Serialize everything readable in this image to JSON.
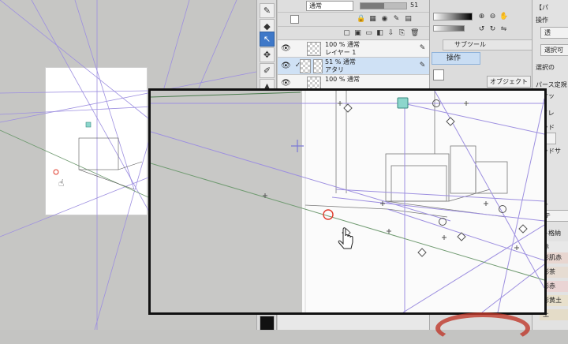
{
  "layer_panel": {
    "blend_mode": "通常",
    "opacity_value": "51",
    "layers": [
      {
        "opacity_line": "100 % 通常",
        "name": "レイヤー 1"
      },
      {
        "opacity_line": "51 % 通常",
        "name": "アタリ"
      },
      {
        "opacity_line": "100 % 通常",
        "name": ""
      }
    ]
  },
  "subtool_panel": {
    "tab_label": "サブツール",
    "operation_label": "操作",
    "object_label": "オブジェクト"
  },
  "property_panel": {
    "header_label": "【パ",
    "operation_label": "操作",
    "btn_1": "透",
    "btn_2": "選択可",
    "selection_label": "選択の",
    "perspective_label": "パース定規",
    "snap_label": "スナッ",
    "eye_label": "アイレ",
    "grid_label": "リッド",
    "grid_sub_label": "リッドサ",
    "auto_label": "オー",
    "auto_btn": "テ",
    "list_label": "スト格納"
  },
  "color_list": [
    {
      "name": "赤",
      "color": "#e8e8e8"
    },
    {
      "name": "彩肌赤",
      "color": "#e8d6d0"
    },
    {
      "name": "彩茶",
      "color": "#e6dcd2"
    },
    {
      "name": "彩赤",
      "color": "#ead4d4"
    },
    {
      "name": "彩黄土",
      "color": "#e8e0cc"
    },
    {
      "name": "土",
      "color": "#e4dcc8"
    }
  ],
  "colors": {
    "accent_blue": "#3e78c8",
    "vanishing_point_red": "#e03a2a",
    "handle_teal": "#8cd6cc",
    "guide_purple": "#9d8fe0",
    "guide_green": "#6f9a70"
  }
}
